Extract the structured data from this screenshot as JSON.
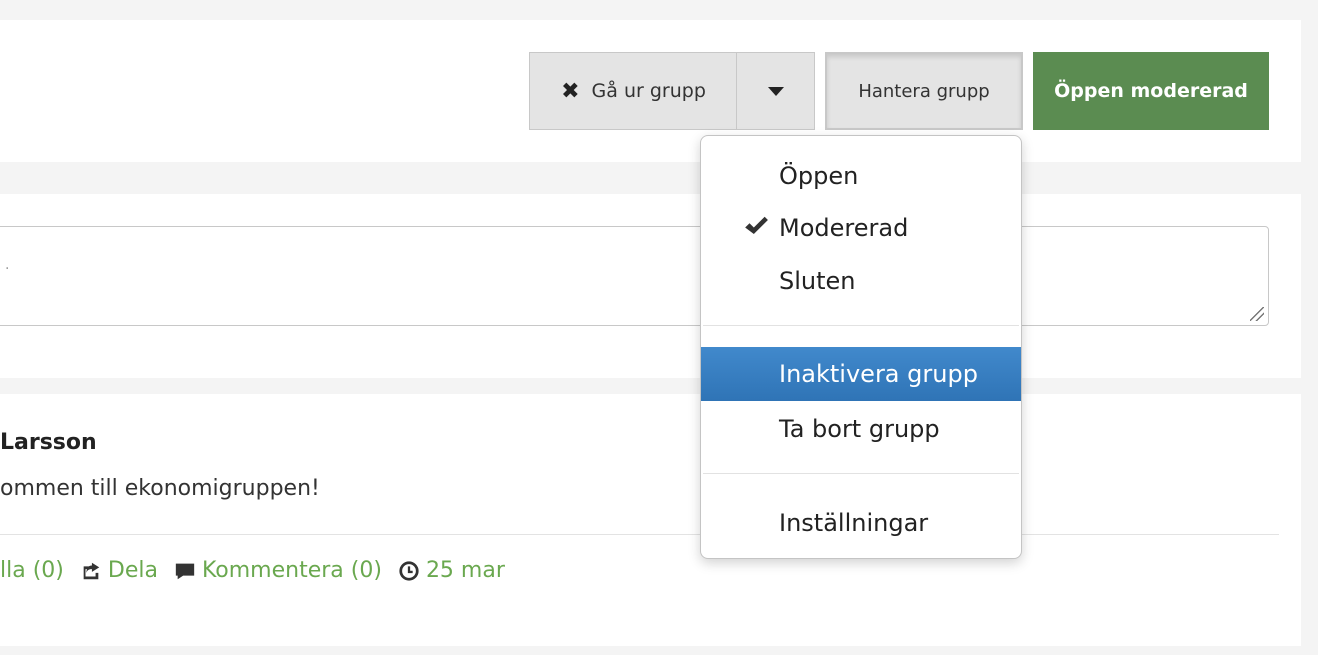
{
  "header": {
    "leave_button": {
      "icon": "x-icon",
      "label": "Gå ur grupp"
    },
    "dropdown_toggle": {
      "icon": "caret-down-icon"
    },
    "manage_button": {
      "label": "Hantera grupp"
    },
    "status_badge": {
      "label": "Öppen modererad",
      "color": "#5b8c51"
    }
  },
  "manage_menu": {
    "items": [
      {
        "label": "Öppen",
        "checked": false
      },
      {
        "label": "Modererad",
        "checked": true
      },
      {
        "label": "Sluten",
        "checked": false
      },
      {
        "label": "Inaktivera grupp",
        "highlighted": true
      },
      {
        "label": "Ta bort grupp"
      },
      {
        "label": "Inställningar"
      }
    ],
    "highlight_color": "#3a80c2"
  },
  "composer": {
    "placeholder": "."
  },
  "feed": {
    "post": {
      "author": "Larsson",
      "message": "ommen till ekonomigruppen!",
      "actions": {
        "like": "lla (0)",
        "share": "Dela",
        "comment": "Kommentera (0)",
        "time": "25 mar"
      }
    }
  },
  "colors": {
    "link": "#6aa84f",
    "background": "#f4f4f4"
  }
}
